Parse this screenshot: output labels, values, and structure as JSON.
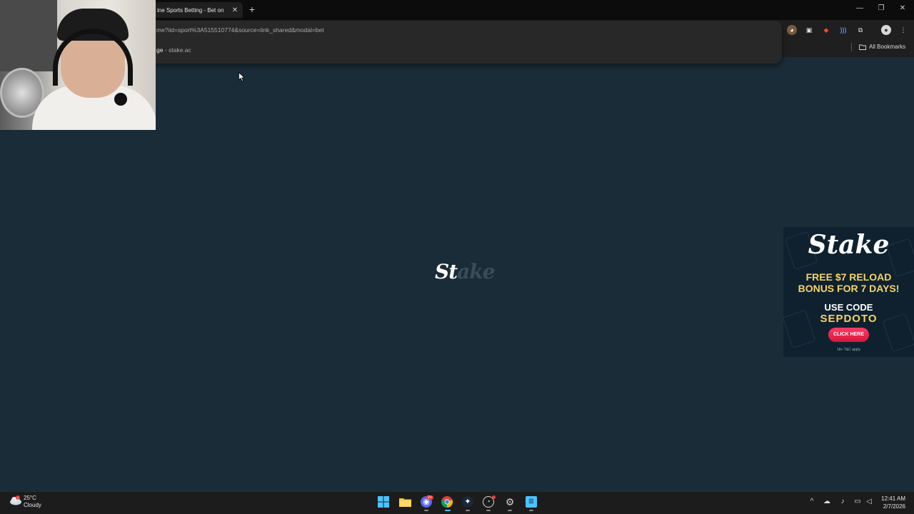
{
  "browser": {
    "tab_title": "ine Sports Betting - Bet on",
    "tab_close": "✕",
    "new_tab": "+",
    "url_text": "me?iid=sport%3A515510774&source=link_shared&modal=bet",
    "suggestion": {
      "prefix": "ge",
      "domain": "- stake.ac"
    },
    "bookmarks_label": "All Bookmarks",
    "window_controls": {
      "minimize": "—",
      "restore": "❐",
      "close": "✕"
    }
  },
  "page": {
    "loader_logo": {
      "main": "St",
      "faded": "ake"
    }
  },
  "ad": {
    "logo": "Stake",
    "offer_line1": "FREE $7 RELOAD",
    "offer_line2": "BONUS FOR 7 DAYS!",
    "use_code": "USE CODE",
    "code": "SEPDOTO",
    "button": "CLICK HERE",
    "terms": "18+ T&C apply",
    "colors": {
      "accent": "#f6d365",
      "button": "#e8234a",
      "background": "#0f212e"
    }
  },
  "taskbar": {
    "weather": {
      "temp": "25°C",
      "condition": "Cloudy",
      "badge": "1"
    },
    "apps": [
      "windows-start",
      "file-explorer",
      "discord",
      "chrome",
      "steam",
      "github-desktop",
      "settings",
      "notepad"
    ],
    "discord_badge": "2+",
    "clock": {
      "time": "12:41 AM",
      "date": "2/7/2026"
    }
  },
  "colors": {
    "page_bg": "#1a2c38",
    "chrome_bg": "#1f1f1f",
    "tabstrip_bg": "#0c0c0c"
  }
}
